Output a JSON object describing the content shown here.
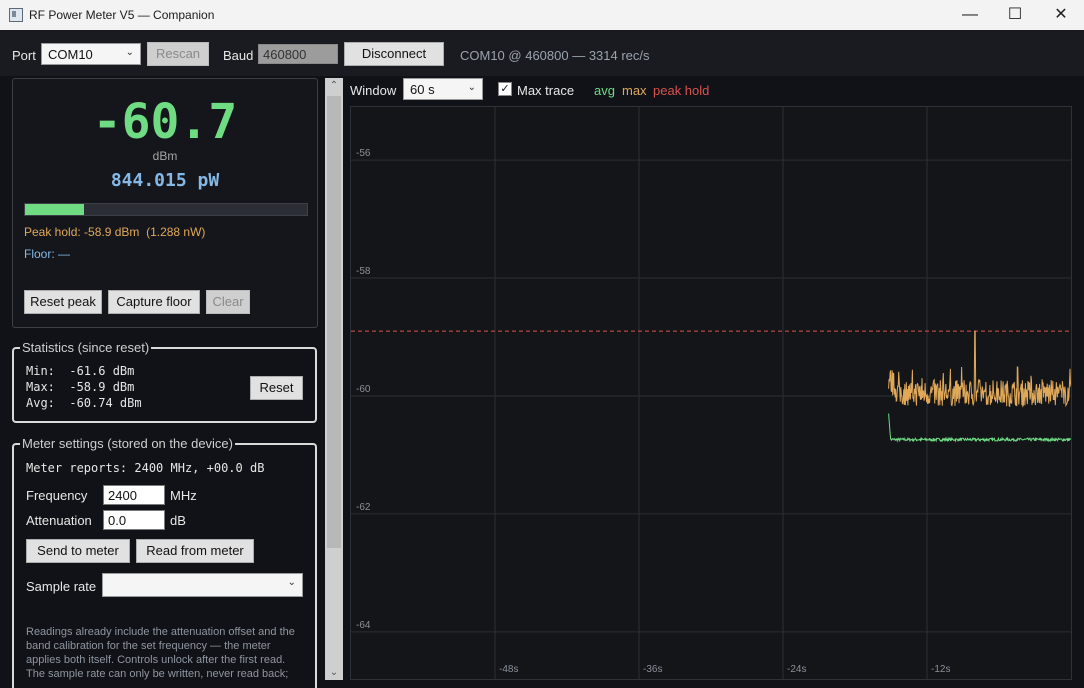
{
  "window": {
    "title": "RF Power Meter V5 — Companion",
    "minimize": "—",
    "maximize": "☐",
    "close": "✕"
  },
  "toolbar": {
    "port_label": "Port",
    "port_value": "COM10",
    "rescan_label": "Rescan",
    "baud_label": "Baud",
    "baud_value": "460800",
    "disconnect_label": "Disconnect",
    "status": "COM10 @ 460800 — 3314 rec/s"
  },
  "reading": {
    "dbm_value": "-60.7",
    "unit": "dBm",
    "power": "844.015 pW",
    "level_fraction": 0.21,
    "peak_hold": "Peak hold: -58.9 dBm  (1.288 nW)",
    "floor": "Floor: —",
    "reset_peak_label": "Reset peak",
    "capture_floor_label": "Capture floor",
    "clear_label": "Clear"
  },
  "statistics": {
    "title": "Statistics (since reset)",
    "min": "Min:  -61.6 dBm",
    "max": "Max:  -58.9 dBm",
    "avg": "Avg:  -60.74 dBm",
    "reset_label": "Reset"
  },
  "settings": {
    "title": "Meter settings (stored on the device)",
    "reports": "Meter reports: 2400 MHz, +00.0 dB",
    "frequency_label": "Frequency",
    "frequency_value": "2400",
    "frequency_unit": "MHz",
    "attenuation_label": "Attenuation",
    "attenuation_value": "0.0",
    "attenuation_unit": "dB",
    "send_label": "Send to meter",
    "read_label": "Read from meter",
    "sample_rate_label": "Sample rate",
    "sample_rate_value": "",
    "note_lines": [
      "Readings already include the attenuation offset and the",
      "band calibration for the set frequency — the meter",
      "applies both itself. Controls unlock after the first read.",
      "The sample rate can only be written, never read back;"
    ]
  },
  "chart_controls": {
    "window_label": "Window",
    "window_value": "60 s",
    "max_trace_label": "Max trace",
    "max_trace_checked": true,
    "legend_avg": "avg",
    "legend_max": "max",
    "legend_peak": "peak hold"
  },
  "colors": {
    "avg": "#6fdc84",
    "max": "#e0a95a",
    "peak": "#d9534f",
    "power": "#86b8e6",
    "accent_green": "#6fdc84",
    "peak_text": "#e0a95a"
  },
  "chart_data": {
    "type": "line",
    "x_ticks": [
      "-48s",
      "-36s",
      "-24s",
      "-12s"
    ],
    "y_ticks": [
      "-56",
      "-58",
      "-60",
      "-62",
      "-64"
    ],
    "xlim": [
      -60,
      0
    ],
    "ylim": [
      -64.8,
      -55.1
    ],
    "peak_hold": -58.9,
    "series": [
      {
        "name": "avg",
        "start": -15.2,
        "end": 0,
        "base": -60.74,
        "spike_at": -15.2,
        "spike_value": -60.3
      },
      {
        "name": "max",
        "start": -15.2,
        "end": 0,
        "base": -59.95,
        "spike_at": -8.0,
        "spike_value": -58.9
      }
    ]
  }
}
